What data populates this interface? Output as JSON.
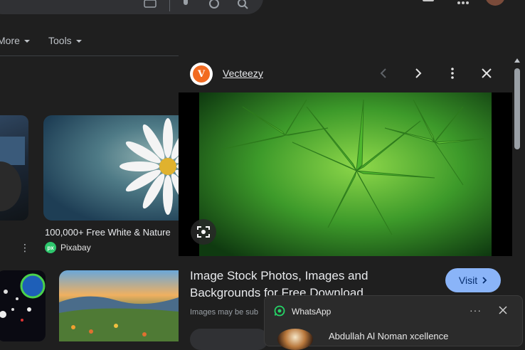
{
  "search_bar": {
    "icons": [
      "keyboard-icon",
      "microphone-icon",
      "lens-icon",
      "search-icon"
    ]
  },
  "header": {
    "apps_icon": "apps-grid-icon"
  },
  "tools_row": {
    "more_label": "More",
    "tools_label": "Tools"
  },
  "results": {
    "item2": {
      "title": "100,000+ Free White & Nature",
      "source": "Pixabay",
      "source_badge": "px"
    }
  },
  "panel": {
    "source_name": "Vecteezy",
    "source_badge": "V",
    "source_color": "#f26b21",
    "title": "Image Stock Photos, Images and Backgrounds for Free Download",
    "visit_label": "Visit",
    "visit_color": "#8ab4f8",
    "disclaimer": "Images may be sub"
  },
  "notification": {
    "app_name": "WhatsApp",
    "sender": "Abdullah Al Noman xcellence",
    "more_label": "···"
  }
}
